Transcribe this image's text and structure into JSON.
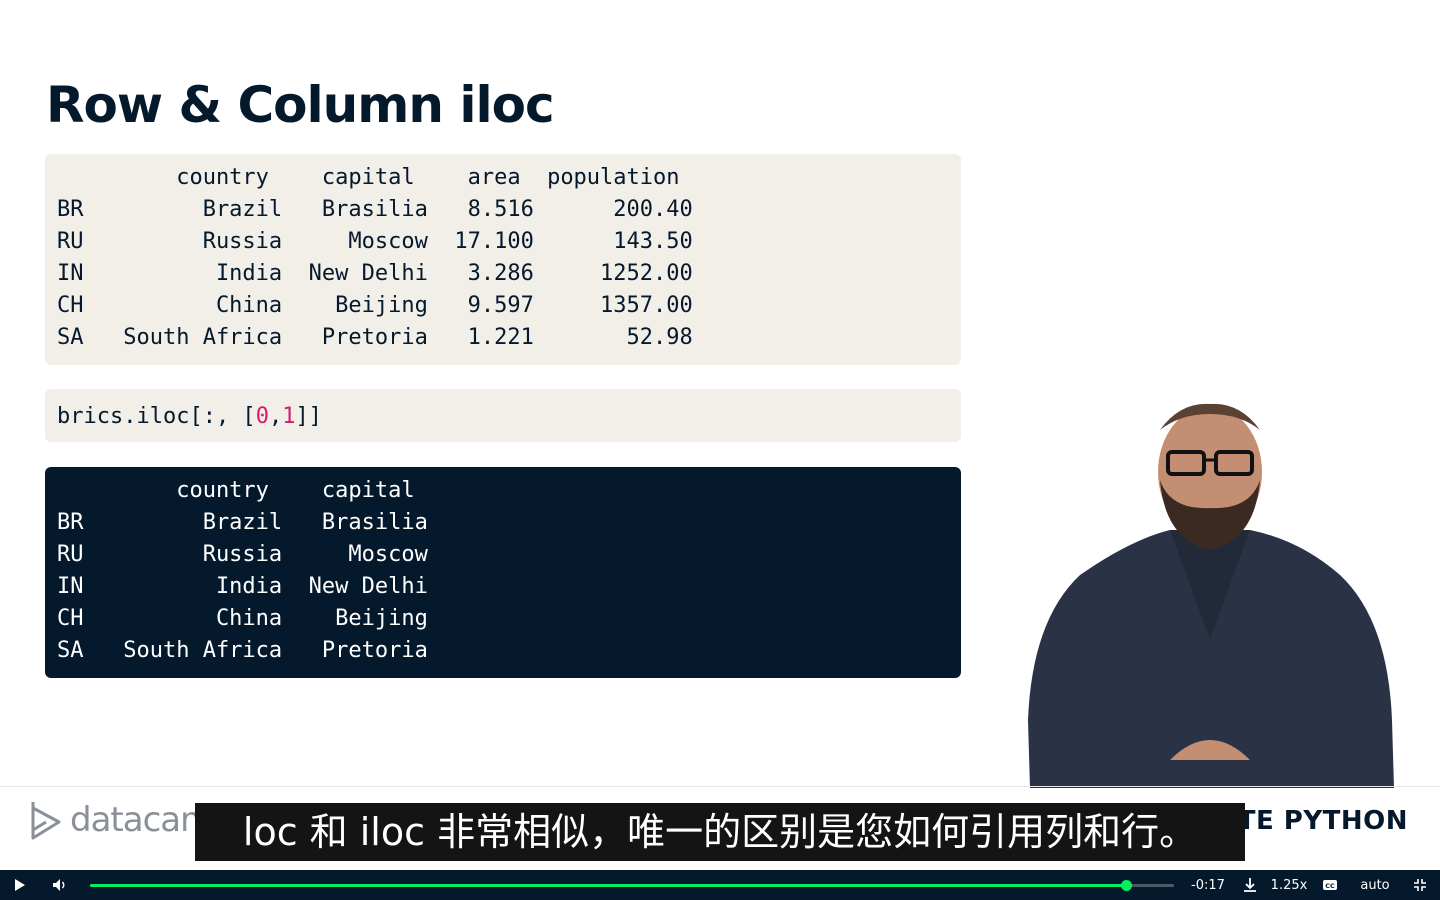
{
  "slide": {
    "title": "Row & Column iloc",
    "table_full": "         country    capital    area  population\nBR         Brazil   Brasilia   8.516      200.40\nRU         Russia     Moscow  17.100      143.50\nIN          India  New Delhi   3.286     1252.00\nCH          China    Beijing   9.597     1357.00\nSA   South Africa   Pretoria   1.221       52.98",
    "code_prefix": "brics.iloc[:, [",
    "code_num1": "0",
    "code_comma": ",",
    "code_num2": "1",
    "code_suffix": "]]",
    "table_result": "         country    capital\nBR         Brazil   Brasilia\nRU         Russia     Moscow\nIN          India  New Delhi\nCH          China    Beijing\nSA   South Africa   Pretoria"
  },
  "footer": {
    "logo_text": "datacamp",
    "course": "INTERMEDIATE PYTHON",
    "subtitle": "loc 和 iloc 非常相似，唯一的区别是您如何引用列和行。"
  },
  "player": {
    "progress_fraction": 0.956,
    "time_remaining": "-0:17",
    "speed": "1.25x",
    "quality": "auto",
    "colors": {
      "bar_bg": "#05192d",
      "progress": "#03ef62"
    }
  }
}
